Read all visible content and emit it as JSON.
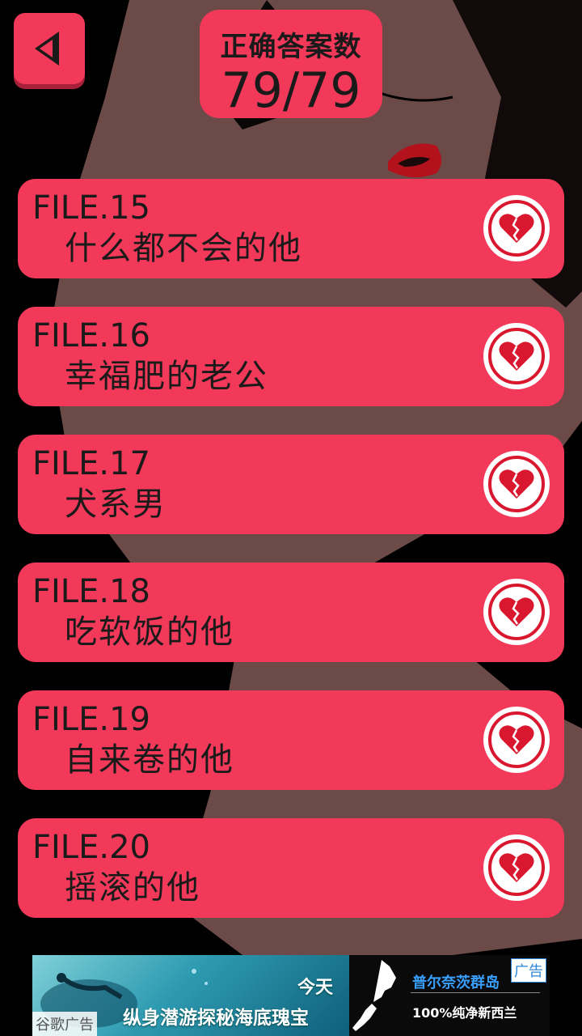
{
  "header": {
    "score_title": "正确答案数",
    "score_value": "79/79"
  },
  "files": [
    {
      "code": "FILE.15",
      "name": "什么都不会的他"
    },
    {
      "code": "FILE.16",
      "name": "幸福肥的老公"
    },
    {
      "code": "FILE.17",
      "name": "犬系男"
    },
    {
      "code": "FILE.18",
      "name": "吃软饭的他"
    },
    {
      "code": "FILE.19",
      "name": "自来卷的他"
    },
    {
      "code": "FILE.20",
      "name": "摇滚的他"
    }
  ],
  "ad": {
    "today": "今天",
    "headline": "纵身潜游探秘海底瑰宝",
    "destination": "普尔奈茨群岛",
    "promo": "100%纯净新西兰",
    "tag": "广告",
    "source": "谷歌广告"
  },
  "colors": {
    "card": "#f2395a",
    "card_shadow": "#a8203a",
    "heart": "#d9172e",
    "background_skin": "#6b4a47"
  },
  "icons": {
    "back": "back-arrow-icon",
    "file_status": "broken-heart-icon"
  }
}
